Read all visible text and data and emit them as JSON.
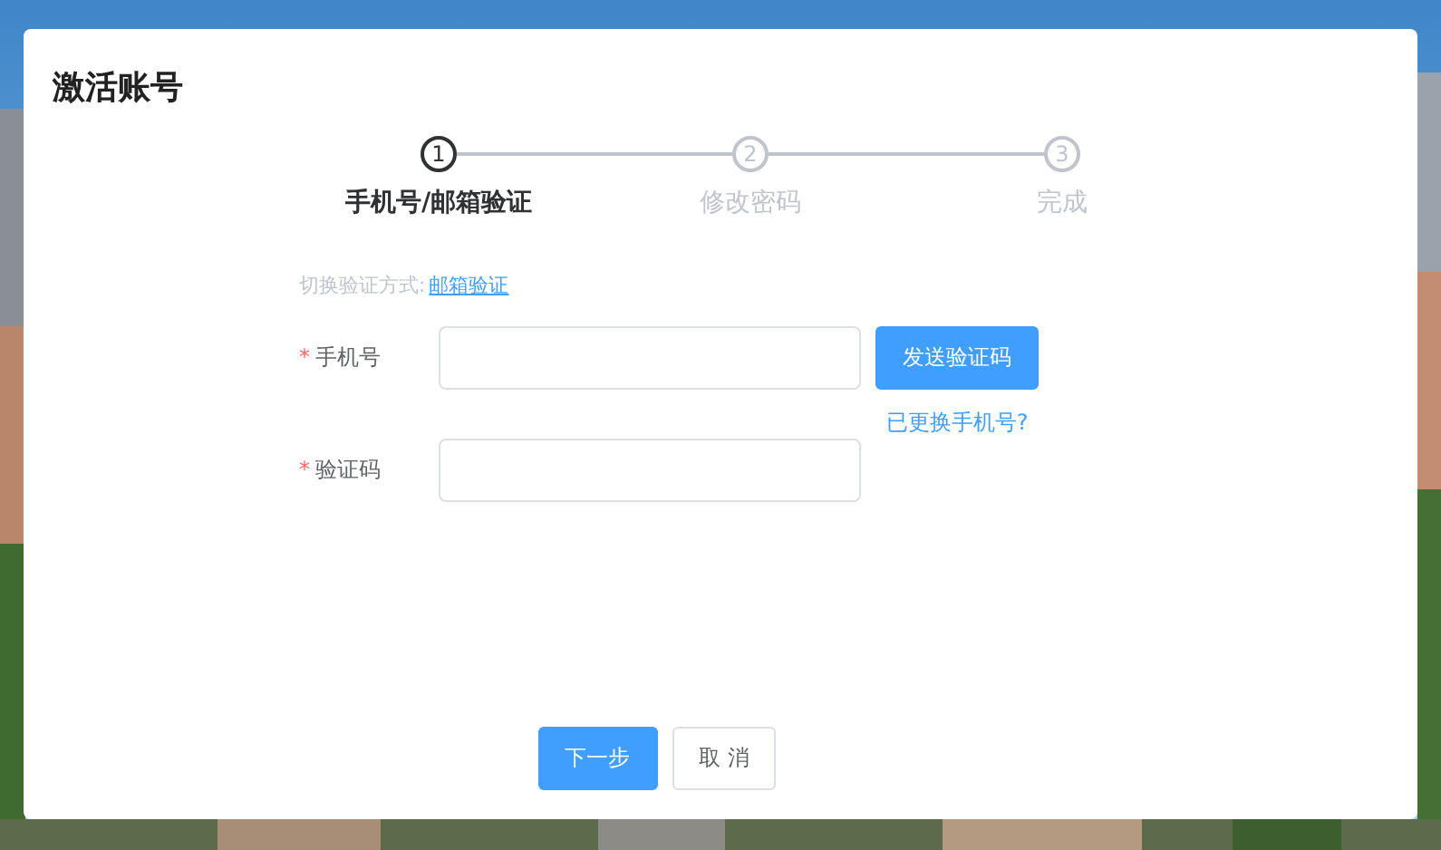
{
  "dialog": {
    "title": "激活账号"
  },
  "steps": [
    {
      "number": "1",
      "label": "手机号/邮箱验证",
      "selected": true
    },
    {
      "number": "2",
      "label": "修改密码",
      "selected": false
    },
    {
      "number": "3",
      "label": "完成",
      "selected": false
    }
  ],
  "switch_method": {
    "label": "切换验证方式:",
    "link": "邮箱验证"
  },
  "fields": [
    {
      "label": "手机号",
      "required_mark": "*",
      "button": "发送验证码",
      "link": "已更换手机号?"
    },
    {
      "label": "验证码",
      "required_mark": "*"
    }
  ],
  "buttons": [
    {
      "label": "下一步",
      "kind": "primary"
    },
    {
      "label": "取 消",
      "kind": "default"
    }
  ]
}
